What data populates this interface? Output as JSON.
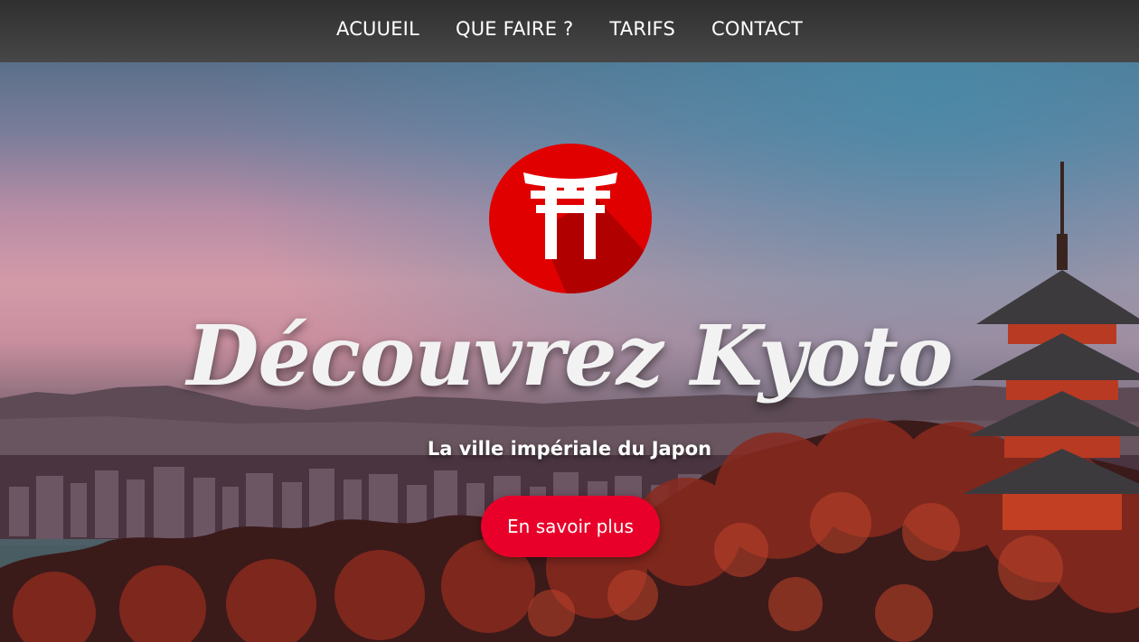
{
  "nav": {
    "items": [
      {
        "label": "ACUUEIL"
      },
      {
        "label": "QUE FAIRE ?"
      },
      {
        "label": "TARIFS"
      },
      {
        "label": "CONTACT"
      }
    ]
  },
  "hero": {
    "title": "Découvrez Kyoto",
    "subtitle": "La ville impériale du Japon",
    "cta_label": "En savoir plus",
    "logo_icon": "torii-gate-icon"
  },
  "colors": {
    "brand_red": "#e8002a",
    "logo_red": "#e10000",
    "navbar": "#3a3a3a"
  }
}
